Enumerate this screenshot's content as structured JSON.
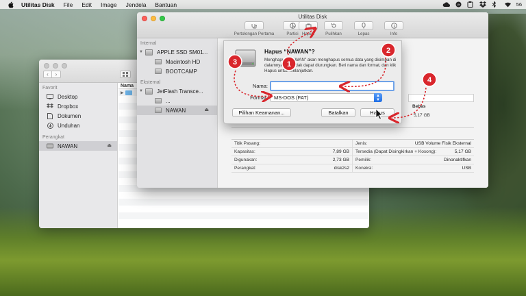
{
  "menubar": {
    "app_name": "Utilitas Disk",
    "items": [
      "File",
      "Edit",
      "Image",
      "Jendela",
      "Bantuan"
    ],
    "clock": "56"
  },
  "finder": {
    "sidebar": {
      "favorites_header": "Favorit",
      "favorites": [
        "Desktop",
        "Dropbox",
        "Dokumen",
        "Unduhan"
      ],
      "devices_header": "Perangkat",
      "device": "NAWAN"
    },
    "column_header": "Nama"
  },
  "disk_utility": {
    "title": "Utilitas Disk",
    "toolbar": [
      {
        "label": "Pertolongan Pertama",
        "icon": "stethoscope-icon"
      },
      {
        "label": "Partisi",
        "icon": "partition-icon"
      },
      {
        "label": "Hapus",
        "icon": "erase-icon"
      },
      {
        "label": "Pulihkan",
        "icon": "restore-icon"
      },
      {
        "label": "Lepas",
        "icon": "unmount-icon"
      },
      {
        "label": "Info",
        "icon": "info-icon"
      }
    ],
    "sidebar": {
      "internal_header": "Internal",
      "internal_disk": "APPLE SSD SM01...",
      "internal_volumes": [
        "Macintosh HD",
        "BOOTCAMP"
      ],
      "external_header": "Eksternal",
      "external_disk": "JetFlash Transce...",
      "external_volumes": [
        "...",
        "NAWAN"
      ]
    },
    "free_label": "Bebas",
    "free_value": "5,17 GB",
    "info_rows": [
      {
        "k1": "Titik Pasang:",
        "v1": "",
        "k2": "Jenis:",
        "v2": "USB Volume Fisik Eksternal"
      },
      {
        "k1": "Kapasitas:",
        "v1": "7,89 GB",
        "k2": "Tersedia (Dapat Disingkirkan + Kosong):",
        "v2": "5,17 GB"
      },
      {
        "k1": "Digunakan:",
        "v1": "2,73 GB",
        "k2": "Pemilik:",
        "v2": "Dinonaktifkan"
      },
      {
        "k1": "Perangkat:",
        "v1": "disk2s2",
        "k2": "Koneksi:",
        "v2": "USB"
      }
    ]
  },
  "dialog": {
    "title": "Hapus “NAWAN”?",
    "message": "Menghapus \"NAWAN\" akan menghapus semua data yang disimpan di dalamnya, dan tidak dapat diurungkan. Beri nama dan format, dan klik Hapus untuk melanjutkan.",
    "name_label": "Nama:",
    "name_value": "",
    "format_label": "Format:",
    "format_value": "MS-DOS (FAT)",
    "security_button": "Pilihan Keamanan...",
    "cancel_button": "Batalkan",
    "erase_button": "Hapus"
  },
  "annotations": {
    "color": "#d9262c",
    "steps": [
      "1",
      "2",
      "3",
      "4"
    ]
  }
}
